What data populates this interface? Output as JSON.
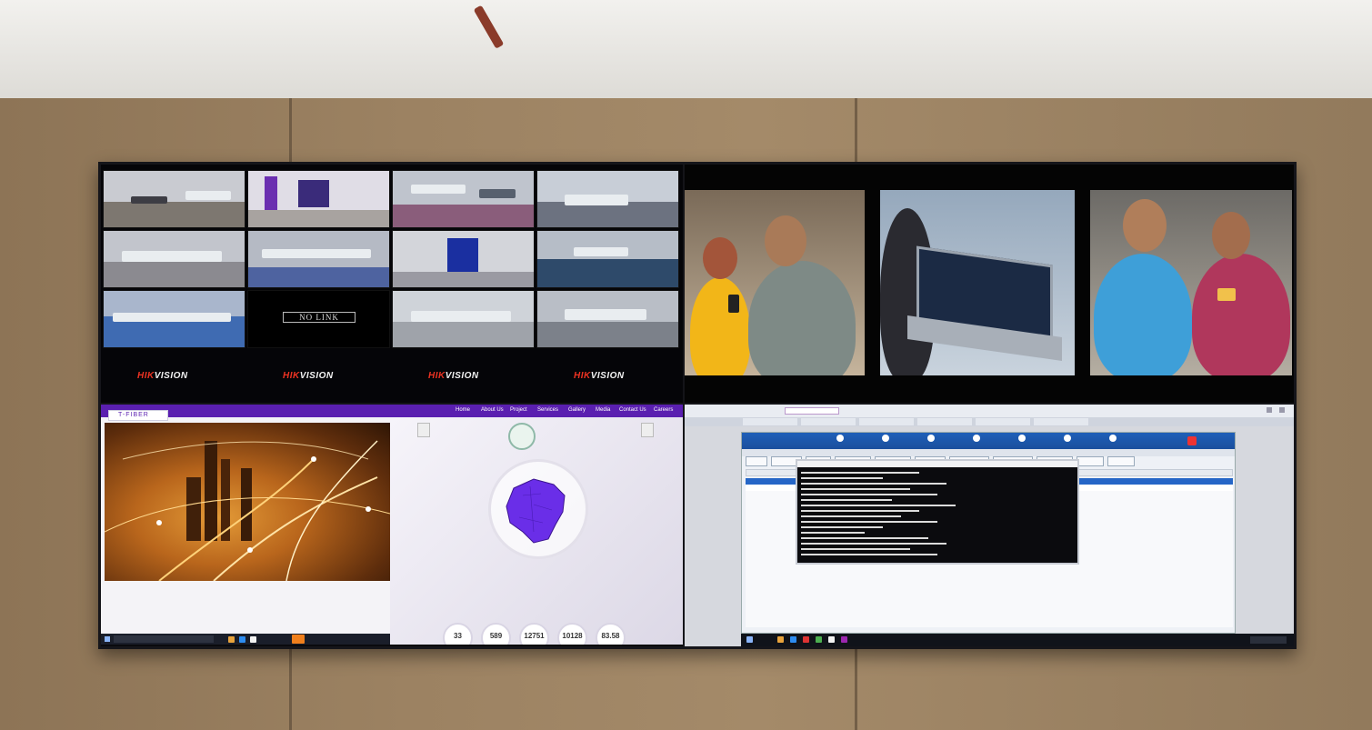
{
  "cctv": {
    "no_link_label": "NO LINK",
    "brand": {
      "prefix": "HIK",
      "suffix": "VISION"
    },
    "brand_count": 4
  },
  "tfiber": {
    "logo_text": "T-FIBER",
    "nav": [
      "Home",
      "About Us",
      "Project",
      "Services",
      "Gallery",
      "Media",
      "Contact Us",
      "Careers"
    ],
    "stats": [
      "33",
      "589",
      "12751",
      "10128",
      "83.58"
    ]
  },
  "colors": {
    "tfiber_purple": "#5a1fb0",
    "hikvision_red": "#e32222",
    "nms_blue": "#1f5fb8"
  }
}
